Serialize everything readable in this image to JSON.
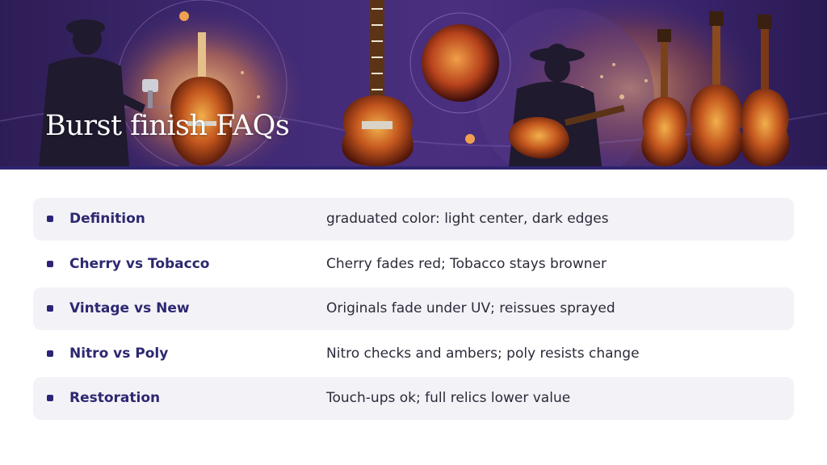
{
  "page": {
    "title": "Burst finish FAQs"
  },
  "faq": {
    "items": [
      {
        "term": "Definition",
        "answer": "graduated color: light center, dark edges"
      },
      {
        "term": "Cherry vs Tobacco",
        "answer": "Cherry fades red; Tobacco stays browner"
      },
      {
        "term": "Vintage vs New",
        "answer": "Originals fade under UV; reissues sprayed"
      },
      {
        "term": "Nitro vs Poly",
        "answer": "Nitro checks and ambers; poly resists change"
      },
      {
        "term": "Restoration",
        "answer": "Touch-ups ok; full relics lower value"
      }
    ]
  },
  "theme": {
    "accent": "#2c2477",
    "row_shade": "#f3f2f7",
    "banner_purple": "#3f2a74"
  }
}
